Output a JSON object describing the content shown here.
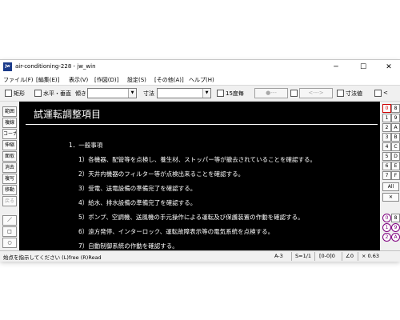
{
  "window": {
    "title": "air-conditioning-228 - jw_win",
    "icon_text": "jw",
    "controls": {
      "minimize": "─",
      "maximize": "☐",
      "close": "✕"
    }
  },
  "menu": [
    "ファイル(F)",
    "[編集(E)]",
    "表示(V)",
    "[作図(D)]",
    "設定(S)",
    "[その他(A)]",
    "ヘルプ(H)"
  ],
  "toolbar": {
    "rect_label": "矩形",
    "horiz_vert_label": "水平・垂直",
    "tilt_label": "傾き",
    "dim_label": "寸法",
    "deg15_label": "15度毎",
    "btn1": "●---",
    "btn2": "<--->",
    "dimval_label": "寸法値",
    "lt_label": "<"
  },
  "left_tools": [
    "範囲",
    "複線",
    "コーナー",
    "伸縮",
    "面取",
    "消去",
    "複写",
    "移動",
    "戻る",
    "／",
    "□",
    "○"
  ],
  "right_tools": {
    "top_pairs": [
      [
        "0",
        "8"
      ],
      [
        "1",
        "9"
      ],
      [
        "2",
        "A"
      ],
      [
        "3",
        "B"
      ],
      [
        "4",
        "C"
      ],
      [
        "5",
        "D"
      ],
      [
        "6",
        "E"
      ],
      [
        "7",
        "F"
      ]
    ],
    "all_label": "All",
    "x_label": "✕",
    "bottom_pairs": [
      [
        "0",
        "8"
      ],
      [
        "1",
        "9"
      ],
      [
        "2",
        "A"
      ]
    ]
  },
  "document": {
    "title": "試運転調整項目",
    "lines": [
      "1．一般事項",
      "1）各機器、配管等を点検し、養生材、ストッパー等が撤去されていることを確認する。",
      "2）天井内機器のフィルター等が点検出来ることを確認する。",
      "3）受電、送電設備の準備完了を確認する。",
      "4）給水、排水設備の準備完了を確認する。",
      "5）ポンプ、空調機、送風機の手元操作による運転及び保護装置の作動を確認する。",
      "6）遠方発停、インターロック、運転故障表示等の電気系統を点検する。",
      "7）自動制御系統の作動を確認する。"
    ]
  },
  "status": {
    "message": "始点を指示してください (L)free (R)Read",
    "paper": "A-3",
    "scale": "S=1/1",
    "layer": "[0-0]0",
    "angle": "∠0",
    "zoom": "× 0.63"
  }
}
